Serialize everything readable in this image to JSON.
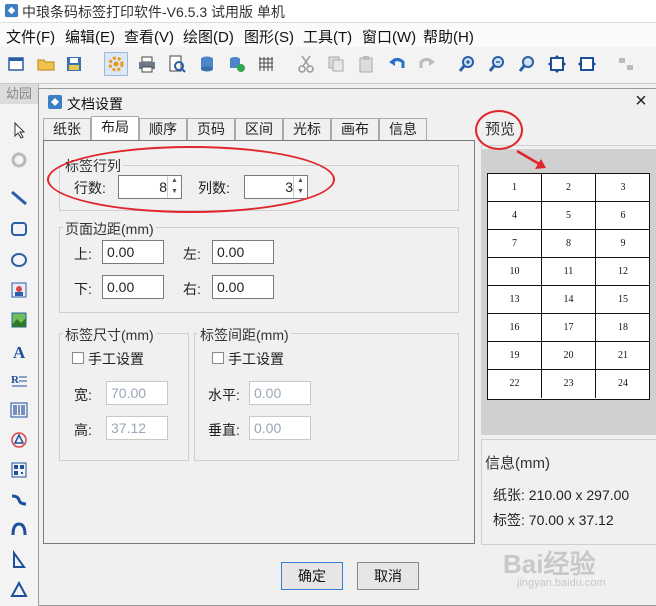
{
  "app": {
    "title": "中琅条码标签打印软件-V6.5.3 试用版 单机"
  },
  "menu": [
    "文件(F)",
    "编辑(E)",
    "查看(V)",
    "绘图(D)",
    "图形(S)",
    "工具(T)",
    "窗口(W)",
    "帮助(H)"
  ],
  "toolbar_icons": [
    "new-file-icon",
    "open-folder-icon",
    "save-icon",
    "settings-gear-icon",
    "print-icon",
    "print-preview-icon",
    "database-icon",
    "database-add-icon",
    "grid-icon",
    "cut-icon",
    "copy-icon",
    "paste-icon",
    "undo-icon",
    "redo-icon",
    "zoom-in-icon",
    "zoom-out-icon",
    "zoom-fit-icon",
    "fit-page-icon",
    "fit-width-icon",
    "align-icon"
  ],
  "left_tools": [
    "select-pointer-icon",
    "rotate-icon",
    "line-icon",
    "rounded-rect-icon",
    "ellipse-icon",
    "image-icon",
    "picture-icon",
    "text-icon",
    "rich-text-icon",
    "barcode-icon",
    "qrcode-icon",
    "matrix-icon",
    "curve-icon",
    "arc-icon",
    "polygon-icon",
    "triangle-icon"
  ],
  "left_panel_tab": "幼园",
  "dialog": {
    "title": "文档设置",
    "close": "×",
    "tabs": [
      "纸张",
      "布局",
      "顺序",
      "页码",
      "区间",
      "光标",
      "画布",
      "信息"
    ],
    "active_tab": 1,
    "label_rows_group": {
      "legend": "标签行列",
      "rows_label": "行数:",
      "rows_value": "8",
      "cols_label": "列数:",
      "cols_value": "3"
    },
    "margins_group": {
      "legend": "页面边距(mm)",
      "top_label": "上:",
      "top_value": "0.00",
      "left_label": "左:",
      "left_value": "0.00",
      "bottom_label": "下:",
      "bottom_value": "0.00",
      "right_label": "右:",
      "right_value": "0.00"
    },
    "size_group": {
      "legend": "标签尺寸(mm)",
      "manual_label": "手工设置",
      "width_label": "宽:",
      "width_value": "70.00",
      "height_label": "高:",
      "height_value": "37.12"
    },
    "spacing_group": {
      "legend": "标签间距(mm)",
      "manual_label": "手工设置",
      "horizontal_label": "水平:",
      "horizontal_value": "0.00",
      "vertical_label": "垂直:",
      "vertical_value": "0.00"
    },
    "preview": {
      "label": "预览",
      "cells": [
        "1",
        "2",
        "3",
        "4",
        "5",
        "6",
        "7",
        "8",
        "9",
        "10",
        "11",
        "12",
        "13",
        "14",
        "15",
        "16",
        "17",
        "18",
        "19",
        "20",
        "21",
        "22",
        "23",
        "24"
      ]
    },
    "info": {
      "legend": "信息(mm)",
      "paper": "纸张: 210.00 x 297.00",
      "label": "标签: 70.00 x 37.12"
    },
    "ok_label": "确定",
    "cancel_label": "取消"
  },
  "watermark": {
    "text": "Bai经验",
    "sub": "jingyan.baidu.com"
  },
  "colors": {
    "annotation_red": "#e0262b",
    "accent_blue": "#3c7fd6"
  }
}
